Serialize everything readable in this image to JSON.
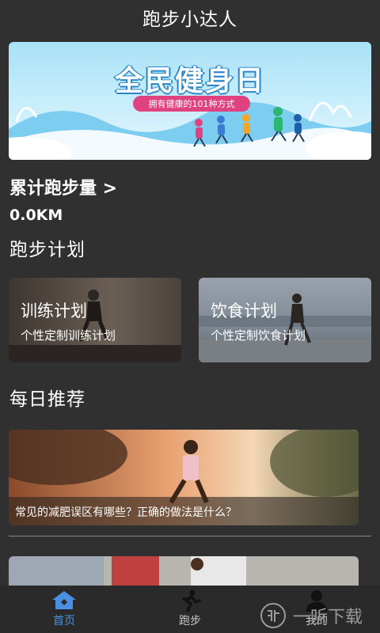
{
  "app": {
    "title": "跑步小达人"
  },
  "banner": {
    "title": "全民健身日",
    "subtitle": "拥有健康的101种方式"
  },
  "mileage": {
    "link_label": "累计跑步量 >",
    "value": "0.0KM"
  },
  "plan_section": {
    "title": "跑步计划",
    "cards": [
      {
        "title": "训练计划",
        "subtitle": "个性定制训练计划"
      },
      {
        "title": "饮食计划",
        "subtitle": "个性定制饮食计划"
      }
    ]
  },
  "recommend_section": {
    "title": "每日推荐",
    "articles": [
      {
        "caption": "常见的减肥误区有哪些？正确的做法是什么？"
      }
    ]
  },
  "tabs": [
    {
      "label": "首页",
      "icon": "home-icon",
      "active": true
    },
    {
      "label": "跑步",
      "icon": "runner-icon",
      "active": false
    },
    {
      "label": "我的",
      "icon": "profile-icon",
      "active": false
    }
  ],
  "watermark": {
    "text": "一听下载",
    "icon": "ting-logo"
  },
  "colors": {
    "accent": "#4a90e2",
    "background": "#303030",
    "tab_inactive": "#c8c8c8"
  }
}
